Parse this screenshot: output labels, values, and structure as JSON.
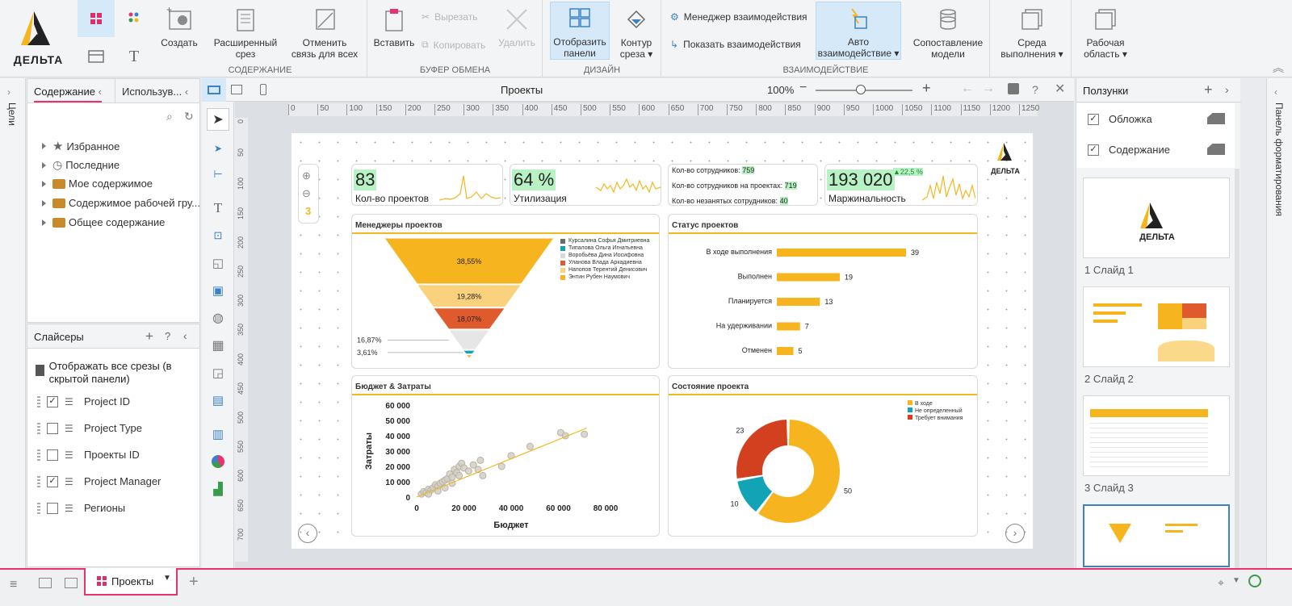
{
  "app": {
    "logo_text": "ДЕЛЬТА"
  },
  "ribbon": {
    "groups": [
      {
        "title": "СОДЕРЖАНИЕ"
      },
      {
        "title": "БУФЕР ОБМЕНА"
      },
      {
        "title": "ДИЗАЙН"
      },
      {
        "title": "ВЗАИМОДЕЙСТВИЕ"
      }
    ],
    "create": "Создать",
    "ext_slice": "Расширенный срез",
    "unlink": "Отменить связь для всех",
    "paste": "Вставить",
    "cut": "Вырезать",
    "copy": "Копировать",
    "delete": "Удалить",
    "show_panel": "Отобразить панели",
    "slice_contour": "Контур среза ▾",
    "interaction_manager": "Менеджер взаимодействия",
    "show_interaction": "Показать взаимодействия",
    "auto_interaction": "Авто взаимодействие ▾",
    "model_compare": "Сопоставление модели",
    "environment": "Среда выполнения ▾",
    "workspace": "Рабочая область ▾"
  },
  "left_rail": {
    "label": "Цели"
  },
  "right_rail": {
    "label": "Панель форматирования"
  },
  "content_panel": {
    "tab_content": "Содержание",
    "tab_used": "Использув...",
    "tree": [
      "Избранное",
      "Последние",
      "Мое содержимое",
      "Содержимое рабочей гру...",
      "Общее содержание"
    ]
  },
  "slicers_panel": {
    "title": "Слайсеры",
    "show_all": "Отображать все срезы (в скрытой панели)",
    "items": [
      {
        "label": "Project ID",
        "checked": true
      },
      {
        "label": "Project Type",
        "checked": false
      },
      {
        "label": "Проекты ID",
        "checked": false
      },
      {
        "label": "Project Manager",
        "checked": true
      },
      {
        "label": "Регионы",
        "checked": false
      }
    ]
  },
  "canvas": {
    "title": "Проекты",
    "zoom": "100%",
    "ruler_h": [
      "0",
      "50",
      "100",
      "150",
      "200",
      "250",
      "300",
      "350",
      "400",
      "450",
      "500",
      "550",
      "600",
      "650",
      "700",
      "750",
      "800",
      "850",
      "900",
      "950",
      "1000",
      "1050",
      "1100",
      "1150",
      "1200",
      "1250"
    ],
    "ruler_v": [
      "0",
      "50",
      "100",
      "150",
      "200",
      "250",
      "300",
      "350",
      "400",
      "450",
      "500",
      "550",
      "600",
      "650",
      "700"
    ]
  },
  "slide": {
    "page_indicator": "3",
    "logo_text": "ДЕЛЬТА",
    "kpi": [
      {
        "value": "83",
        "label": "Кол-во проектов"
      },
      {
        "value": "64 %",
        "label": "Утилизация"
      },
      {
        "value": "193 020",
        "label": "Маржинальность",
        "delta": "▲22,5 %"
      }
    ],
    "staff": [
      {
        "label": "Кол-во сотрудников:",
        "value": "759"
      },
      {
        "label": "Кол-во сотрудников на проектах:",
        "value": "719"
      },
      {
        "label": "Кол-во незанятых сотрудников:",
        "value": "40"
      }
    ]
  },
  "charts": {
    "managers": {
      "title": "Менеджеры проектов"
    },
    "status": {
      "title": "Статус проектов"
    },
    "budget": {
      "title": "Бюджет & Затраты"
    },
    "state": {
      "title": "Состояние проекта"
    }
  },
  "chart_data": [
    {
      "type": "funnel",
      "title": "Менеджеры проектов",
      "series": [
        {
          "name": "Курсалина Софья Дмитриевна",
          "value": 38.55,
          "label": "38,55%",
          "color": "#f6b51f"
        },
        {
          "name": "Типалова Ольга Игнатьевна",
          "value": 19.28,
          "label": "19,28%",
          "color": "#fad27e"
        },
        {
          "name": "Воробьёва Дина Иосифовна",
          "value": 18.07,
          "label": "18,07%",
          "color": "#df5a2c"
        },
        {
          "name": "Уланова Влада Аркадиевна",
          "value": 16.87,
          "label": "16,87%",
          "color": "#e6e6e6"
        },
        {
          "name": "Напопов Терентий Денисович",
          "value": 3.61,
          "label": "3,61%",
          "color": "#13a3b6"
        },
        {
          "name": "Энтин Рубен Наумович",
          "value": 3.62,
          "label": "",
          "color": "#f6b51f"
        }
      ],
      "legend_colors": [
        "#6c6c6c",
        "#13a3b6",
        "#d9d9d9",
        "#df5a2c",
        "#fad27e",
        "#f6b51f"
      ]
    },
    {
      "type": "bar",
      "title": "Статус проектов",
      "categories": [
        "В ходе выполнения",
        "Выполнен",
        "Планируется",
        "На удерживании",
        "Отменен"
      ],
      "values": [
        39,
        19,
        13,
        7,
        5
      ],
      "color": "#f6b51f"
    },
    {
      "type": "scatter",
      "title": "Бюджет & Затраты",
      "xlabel": "Бюджет",
      "ylabel": "Затраты",
      "xlim": [
        0,
        80000
      ],
      "ylim": [
        0,
        60000
      ],
      "xticks": [
        "0",
        "20 000",
        "40 000",
        "60 000",
        "80 000"
      ],
      "yticks": [
        "0",
        "10 000",
        "20 000",
        "30 000",
        "40 000",
        "50 000",
        "60 000"
      ],
      "points": [
        [
          2000,
          2000
        ],
        [
          3000,
          3500
        ],
        [
          4000,
          3000
        ],
        [
          5000,
          5000
        ],
        [
          6000,
          4500
        ],
        [
          7000,
          6000
        ],
        [
          8000,
          8000
        ],
        [
          9000,
          7000
        ],
        [
          10000,
          9000
        ],
        [
          11000,
          10000
        ],
        [
          12000,
          11000
        ],
        [
          13000,
          12000
        ],
        [
          14000,
          15000
        ],
        [
          15000,
          13000
        ],
        [
          16000,
          18000
        ],
        [
          17000,
          16000
        ],
        [
          18000,
          20000
        ],
        [
          18000,
          14000
        ],
        [
          19000,
          22000
        ],
        [
          20000,
          19000
        ],
        [
          22000,
          17000
        ],
        [
          24000,
          21000
        ],
        [
          26000,
          18000
        ],
        [
          27000,
          24000
        ],
        [
          28000,
          14000
        ],
        [
          36000,
          20000
        ],
        [
          40000,
          27000
        ],
        [
          48000,
          33000
        ],
        [
          61000,
          42000
        ],
        [
          63000,
          40000
        ],
        [
          71000,
          41000
        ],
        [
          5000,
          2000
        ],
        [
          9000,
          4000
        ],
        [
          12000,
          6000
        ],
        [
          15000,
          9000
        ]
      ],
      "trend": [
        [
          0,
          0
        ],
        [
          72000,
          45000
        ]
      ]
    },
    {
      "type": "pie",
      "title": "Состояние проекта",
      "labels": [
        "В ходе",
        "Не определенный",
        "Требует внимания"
      ],
      "values": [
        50,
        10,
        23
      ],
      "colors": [
        "#f6b51f",
        "#13a3b6",
        "#d2401f"
      ]
    }
  ],
  "right_panel": {
    "title": "Ползунки",
    "toggles": [
      {
        "label": "Обложка",
        "checked": true
      },
      {
        "label": "Содержание",
        "checked": true
      }
    ],
    "slides": [
      "1 Слайд 1",
      "2 Слайд 2",
      "3 Слайд 3"
    ]
  },
  "bottom": {
    "tab": "Проекты"
  }
}
